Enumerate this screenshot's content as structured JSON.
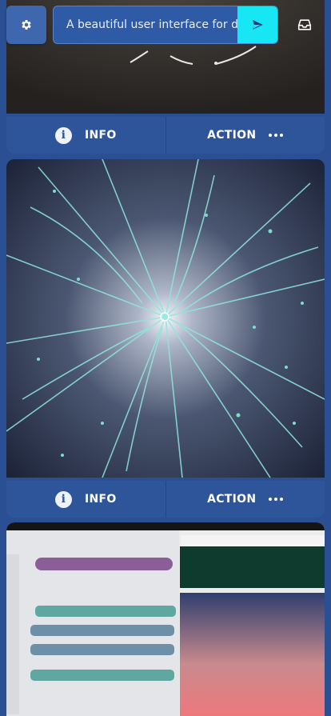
{
  "prompt": {
    "value": "A beautiful user interface for dre",
    "placeholder": ""
  },
  "icons": {
    "settings": "gear-icon",
    "send": "send-icon",
    "inbox": "inbox-icon",
    "info": "info-icon",
    "more": "more-dots-icon"
  },
  "cards": [
    {
      "info_label": "INFO",
      "action_label": "ACTION"
    },
    {
      "info_label": "INFO",
      "action_label": "ACTION"
    }
  ],
  "colors": {
    "background": "#2a4f93",
    "action_bar": "#2e5499",
    "send_accent": "#17e6f4"
  }
}
